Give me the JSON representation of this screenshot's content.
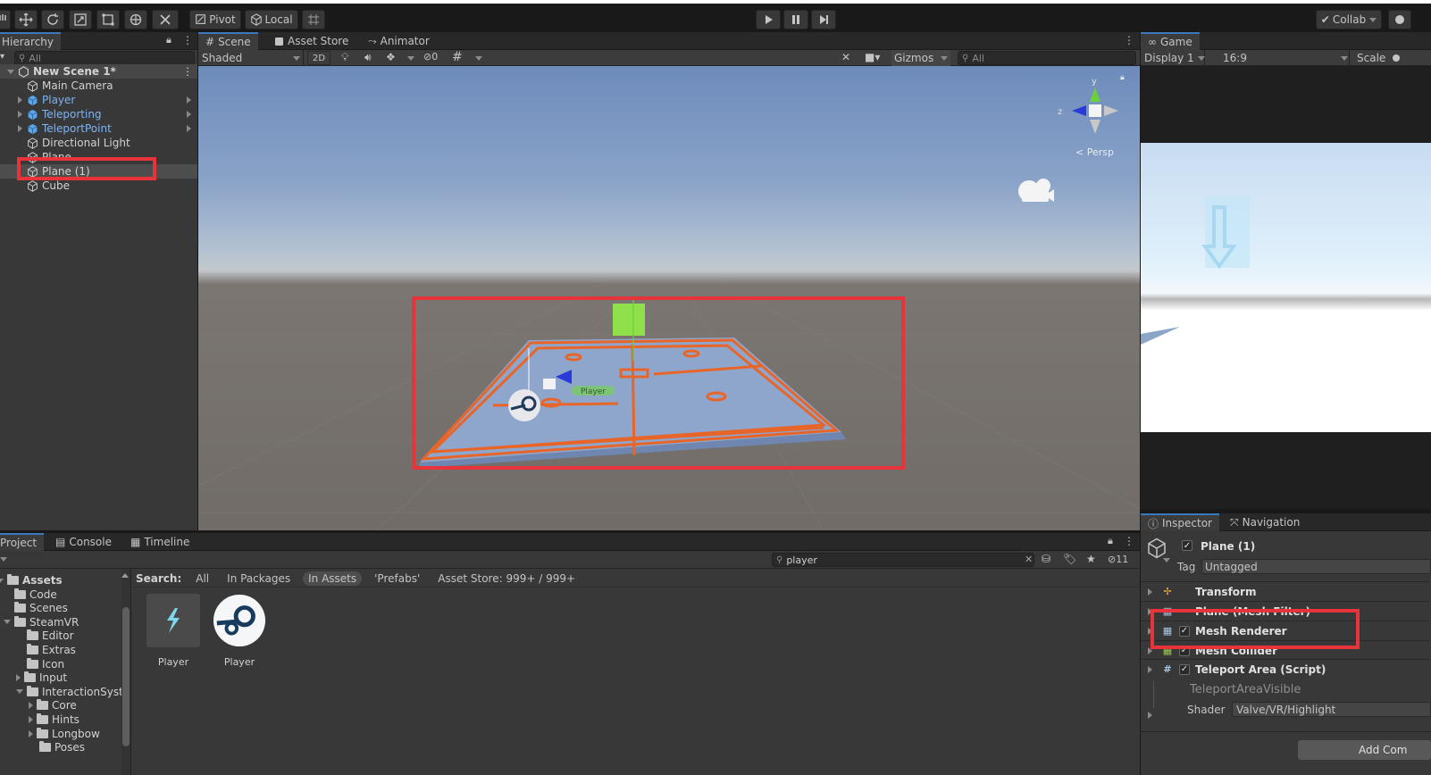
{
  "toolbar": {
    "pivot_label": "Pivot",
    "local_label": "Local",
    "collab_label": "Collab"
  },
  "hierarchy": {
    "tab_label": "Hierarchy",
    "search_placeholder": "All",
    "scene_name": "New Scene 1*",
    "items": [
      {
        "label": "Main Camera",
        "prefab": false,
        "expandable": false
      },
      {
        "label": "Player",
        "prefab": true,
        "expandable": true
      },
      {
        "label": "Teleporting",
        "prefab": true,
        "expandable": true
      },
      {
        "label": "TeleportPoint",
        "prefab": true,
        "expandable": true
      },
      {
        "label": "Directional Light",
        "prefab": false,
        "expandable": false
      },
      {
        "label": "Plane",
        "prefab": false,
        "expandable": false
      },
      {
        "label": "Plane (1)",
        "prefab": false,
        "expandable": false,
        "selected": true
      },
      {
        "label": "Cube",
        "prefab": false,
        "expandable": false
      }
    ]
  },
  "scene_view": {
    "tabs": [
      "Scene",
      "Asset Store",
      "Animator"
    ],
    "shading_mode": "Shaded",
    "mode_2d": "2D",
    "hidden_count": "0",
    "gizmos_label": "Gizmos",
    "search_placeholder": "All",
    "persp_label": "Persp",
    "player_tag": "Player",
    "axis_y": "y",
    "axis_z": "z"
  },
  "game_view": {
    "tab_label": "Game",
    "display": "Display 1",
    "aspect": "16:9",
    "scale_label": "Scale"
  },
  "project": {
    "tabs": [
      "Project",
      "Console",
      "Timeline"
    ],
    "search_value": "player",
    "hidden_count": "11",
    "search_label": "Search:",
    "filters": [
      "All",
      "In Packages",
      "In Assets",
      "'Prefabs'",
      "Asset Store: 999+ / 999+"
    ],
    "active_filter_index": 2,
    "tree": [
      {
        "label": "Assets",
        "depth": 0,
        "bold": true,
        "expanded": true
      },
      {
        "label": "Code",
        "depth": 1
      },
      {
        "label": "Scenes",
        "depth": 1
      },
      {
        "label": "SteamVR",
        "depth": 1,
        "expanded": true
      },
      {
        "label": "Editor",
        "depth": 2
      },
      {
        "label": "Extras",
        "depth": 2
      },
      {
        "label": "Icon",
        "depth": 2
      },
      {
        "label": "Input",
        "depth": 2,
        "collapsed": true
      },
      {
        "label": "InteractionSystem",
        "depth": 2,
        "expanded": true
      },
      {
        "label": "Core",
        "depth": 3,
        "collapsed": true
      },
      {
        "label": "Hints",
        "depth": 3,
        "collapsed": true
      },
      {
        "label": "Longbow",
        "depth": 3,
        "collapsed": true
      },
      {
        "label": "Poses",
        "depth": 3
      }
    ],
    "assets": [
      {
        "label": "Player",
        "icon": "teleport-prefab-icon"
      },
      {
        "label": "Player",
        "icon": "steam-logo-icon"
      }
    ]
  },
  "inspector": {
    "tabs": [
      "Inspector",
      "Navigation"
    ],
    "object_name": "Plane (1)",
    "tag_label": "Tag",
    "tag_value": "Untagged",
    "components": [
      {
        "label": "Transform",
        "checkbox": false
      },
      {
        "label": "Plane (Mesh Filter)",
        "checkbox": false
      },
      {
        "label": "Mesh Renderer",
        "checkbox": true
      },
      {
        "label": "Mesh Collider",
        "checkbox": true
      },
      {
        "label": "Teleport Area (Script)",
        "checkbox": true
      }
    ],
    "material_name": "TeleportAreaVisible",
    "shader_label": "Shader",
    "shader_value": "Valve/VR/Highlight",
    "add_component_label": "Add Com"
  },
  "colors": {
    "highlight_red": "#e8333b",
    "prefab_blue": "#7cb4f5",
    "nav_orange": "#e8652a",
    "accent": "#3a79bb"
  }
}
